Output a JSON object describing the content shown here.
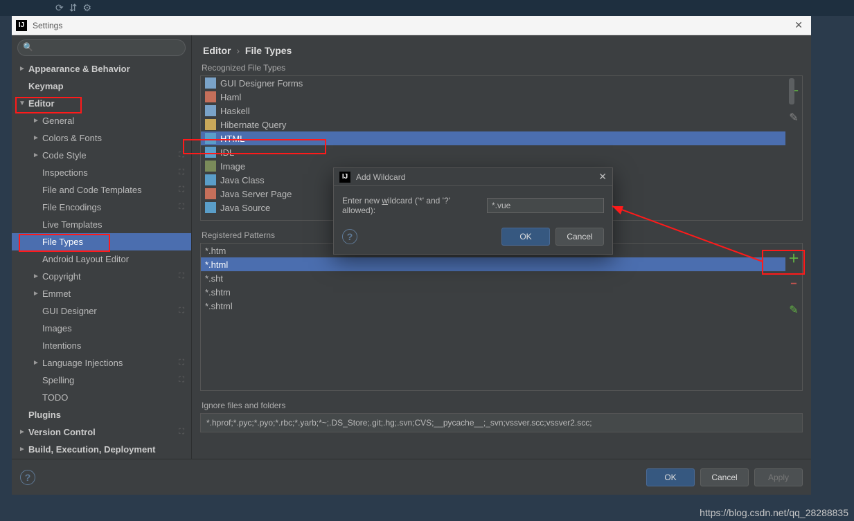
{
  "window": {
    "title": "Settings"
  },
  "sidebar": {
    "search_placeholder": "",
    "items": [
      {
        "label": "Appearance & Behavior",
        "bold": true,
        "arrow": "►",
        "level": 0
      },
      {
        "label": "Keymap",
        "bold": true,
        "arrow": "",
        "level": 0
      },
      {
        "label": "Editor",
        "bold": true,
        "arrow": "▼",
        "level": 0,
        "highlight": true
      },
      {
        "label": "General",
        "arrow": "►",
        "level": 1
      },
      {
        "label": "Colors & Fonts",
        "arrow": "►",
        "level": 1
      },
      {
        "label": "Code Style",
        "arrow": "►",
        "level": 1,
        "tag": "⛶"
      },
      {
        "label": "Inspections",
        "arrow": "",
        "level": 1,
        "tag": "⛶"
      },
      {
        "label": "File and Code Templates",
        "arrow": "",
        "level": 1,
        "tag": "⛶"
      },
      {
        "label": "File Encodings",
        "arrow": "",
        "level": 1,
        "tag": "⛶"
      },
      {
        "label": "Live Templates",
        "arrow": "",
        "level": 1
      },
      {
        "label": "File Types",
        "arrow": "",
        "level": 1,
        "selected": true,
        "highlight": true
      },
      {
        "label": "Android Layout Editor",
        "arrow": "",
        "level": 1
      },
      {
        "label": "Copyright",
        "arrow": "►",
        "level": 1,
        "tag": "⛶"
      },
      {
        "label": "Emmet",
        "arrow": "►",
        "level": 1
      },
      {
        "label": "GUI Designer",
        "arrow": "",
        "level": 1,
        "tag": "⛶"
      },
      {
        "label": "Images",
        "arrow": "",
        "level": 1
      },
      {
        "label": "Intentions",
        "arrow": "",
        "level": 1
      },
      {
        "label": "Language Injections",
        "arrow": "►",
        "level": 1,
        "tag": "⛶"
      },
      {
        "label": "Spelling",
        "arrow": "",
        "level": 1,
        "tag": "⛶"
      },
      {
        "label": "TODO",
        "arrow": "",
        "level": 1
      },
      {
        "label": "Plugins",
        "bold": true,
        "arrow": "",
        "level": 0
      },
      {
        "label": "Version Control",
        "bold": true,
        "arrow": "►",
        "level": 0,
        "tag": "⛶"
      },
      {
        "label": "Build, Execution, Deployment",
        "bold": true,
        "arrow": "►",
        "level": 0
      }
    ]
  },
  "content": {
    "breadcrumb": {
      "root": "Editor",
      "current": "File Types"
    },
    "recognized_label": "Recognized File Types",
    "file_types": [
      {
        "label": "GUI Designer Forms",
        "color": "#7aa3c9"
      },
      {
        "label": "Haml",
        "color": "#c56f5a"
      },
      {
        "label": "Haskell",
        "color": "#7aa3c9"
      },
      {
        "label": "Hibernate Query",
        "color": "#c9a85a"
      },
      {
        "label": "HTML",
        "color": "#5a9ec9",
        "selected": true,
        "highlight": true
      },
      {
        "label": "IDL",
        "color": "#5a9ec9"
      },
      {
        "label": "Image",
        "color": "#7a8b5a"
      },
      {
        "label": "Java Class",
        "color": "#5a9ec9"
      },
      {
        "label": "Java Server Page",
        "color": "#c56f5a"
      },
      {
        "label": "Java Source",
        "color": "#5a9ec9"
      }
    ],
    "registered_label": "Registered Patterns",
    "patterns": [
      {
        "label": "*.htm"
      },
      {
        "label": "*.html",
        "selected": true
      },
      {
        "label": "*.sht"
      },
      {
        "label": "*.shtm"
      },
      {
        "label": "*.shtml"
      }
    ],
    "ignore_label": "Ignore files and folders",
    "ignore_value": "*.hprof;*.pyc;*.pyo;*.rbc;*.yarb;*~;.DS_Store;.git;.hg;.svn;CVS;__pycache__;_svn;vssver.scc;vssver2.scc;"
  },
  "modal": {
    "title": "Add Wildcard",
    "label_pre": "Enter new ",
    "label_underline": "w",
    "label_post": "ildcard ('*' and '?' allowed):",
    "value": "*.vue",
    "ok": "OK",
    "cancel": "Cancel"
  },
  "footer": {
    "ok": "OK",
    "cancel": "Cancel",
    "apply": "Apply"
  },
  "watermark": "https://blog.csdn.net/qq_28288835"
}
